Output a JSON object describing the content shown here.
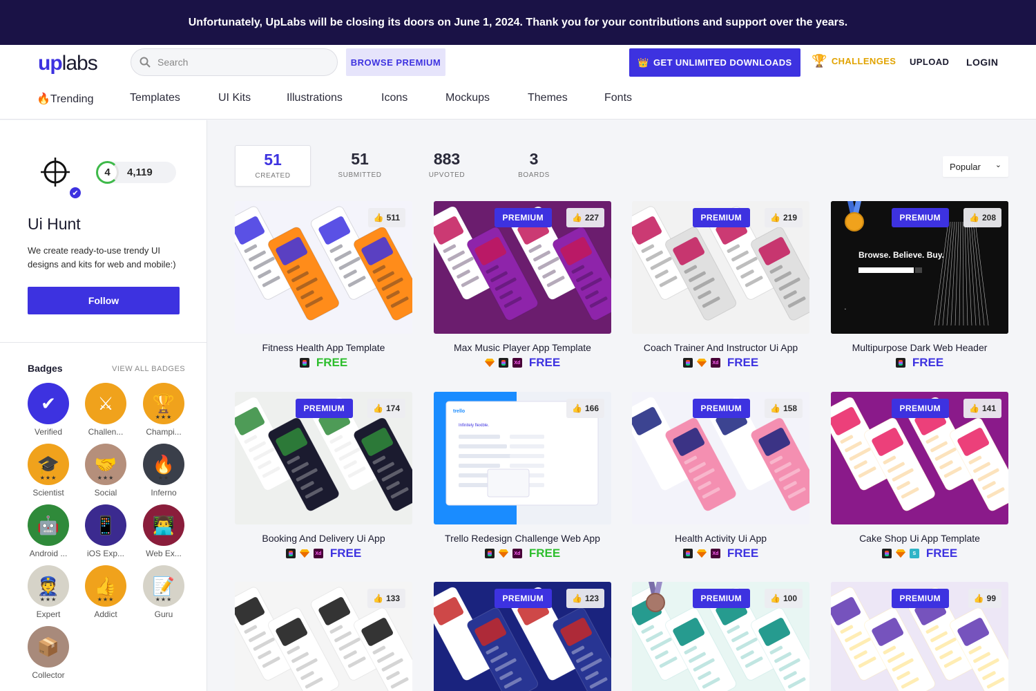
{
  "banner": "Unfortunately, UpLabs will be closing its doors on June 1, 2024. Thank you for your contributions and support over the years.",
  "header": {
    "logo_up": "up",
    "logo_labs": "labs",
    "search_placeholder": "Search",
    "browse_premium": "BROWSE PREMIUM",
    "unlimited": "GET UNLIMITED DOWNLOADS",
    "challenges": "CHALLENGES",
    "upload": "UPLOAD",
    "login": "LOGIN"
  },
  "categories": [
    "🔥Trending",
    "Templates",
    "UI Kits",
    "Illustrations",
    "Icons",
    "Mockups",
    "Themes",
    "Fonts"
  ],
  "profile": {
    "level": "4",
    "points": "4,119",
    "name": "Ui Hunt",
    "bio": "We create ready-to-use trendy UI designs and kits for web and mobile:)",
    "follow": "Follow",
    "badges_title": "Badges",
    "view_all": "VIEW ALL BADGES"
  },
  "badges": [
    {
      "label": "Verified",
      "icon": "check-icon",
      "color": "#3d32e0",
      "glyph": "✔",
      "stars": ""
    },
    {
      "label": "Challen...",
      "icon": "swords-icon",
      "color": "#f0a21c",
      "glyph": "⚔",
      "stars": ""
    },
    {
      "label": "Champi...",
      "icon": "trophy-icon",
      "color": "#f0a21c",
      "glyph": "🏆",
      "stars": "★★★"
    },
    {
      "label": "Scientist",
      "icon": "grad-cap-icon",
      "color": "#f0a21c",
      "glyph": "🎓",
      "stars": "★★★"
    },
    {
      "label": "Social",
      "icon": "handshake-icon",
      "color": "#b58f7b",
      "glyph": "🤝",
      "stars": "★★★"
    },
    {
      "label": "Inferno",
      "icon": "fire-icon",
      "color": "#3a3f4a",
      "glyph": "🔥",
      "stars": "★★"
    },
    {
      "label": "Android ...",
      "icon": "robot-icon",
      "color": "#2f8a3a",
      "glyph": "🤖",
      "stars": ""
    },
    {
      "label": "iOS Exp...",
      "icon": "phone-icon",
      "color": "#3b2a8f",
      "glyph": "📱",
      "stars": ""
    },
    {
      "label": "Web Ex...",
      "icon": "laptop-user-icon",
      "color": "#8a1d3b",
      "glyph": "👨‍💻",
      "stars": ""
    },
    {
      "label": "Expert",
      "icon": "expert-icon",
      "color": "#d6d3c8",
      "glyph": "👮",
      "stars": "★★★"
    },
    {
      "label": "Addict",
      "icon": "thumbs-up-icon",
      "color": "#f0a21c",
      "glyph": "👍",
      "stars": "★★★"
    },
    {
      "label": "Guru",
      "icon": "notepad-icon",
      "color": "#d6d3c8",
      "glyph": "📝",
      "stars": "★★★"
    },
    {
      "label": "Collector",
      "icon": "box-icon",
      "color": "#a88a7b",
      "glyph": "📦",
      "stars": ""
    }
  ],
  "stats": [
    {
      "num": "51",
      "label": "CREATED"
    },
    {
      "num": "51",
      "label": "SUBMITTED"
    },
    {
      "num": "883",
      "label": "UPVOTED"
    },
    {
      "num": "3",
      "label": "BOARDS"
    }
  ],
  "sort": "Popular",
  "cards": [
    {
      "title": "Fitness Health App Template",
      "likes": "511",
      "premium": false,
      "tools": [
        "figma"
      ],
      "price": "FREE",
      "price_color": "green"
    },
    {
      "title": "Max Music Player App Template",
      "likes": "227",
      "premium": true,
      "tools": [
        "sketch",
        "figma",
        "xd"
      ],
      "price": "FREE",
      "price_color": "blue"
    },
    {
      "title": "Coach Trainer And Instructor Ui App",
      "likes": "219",
      "premium": true,
      "tools": [
        "figma",
        "sketch",
        "xd"
      ],
      "price": "FREE",
      "price_color": "blue"
    },
    {
      "title": "Multipurpose Dark Web Header",
      "likes": "208",
      "premium": true,
      "tools": [
        "figma"
      ],
      "price": "FREE",
      "price_color": "blue"
    },
    {
      "title": "Booking And Delivery Ui App",
      "likes": "174",
      "premium": true,
      "tools": [
        "figma",
        "sketch",
        "xd"
      ],
      "price": "FREE",
      "price_color": "blue"
    },
    {
      "title": "Trello Redesign Challenge Web App",
      "likes": "166",
      "premium": false,
      "tools": [
        "figma",
        "sketch",
        "xd"
      ],
      "price": "FREE",
      "price_color": "green"
    },
    {
      "title": "Health Activity Ui App",
      "likes": "158",
      "premium": true,
      "tools": [
        "figma",
        "sketch",
        "xd"
      ],
      "price": "FREE",
      "price_color": "blue"
    },
    {
      "title": "Cake Shop Ui App Template",
      "likes": "141",
      "premium": true,
      "tools": [
        "figma",
        "sketch",
        "studio"
      ],
      "price": "FREE",
      "price_color": "blue"
    },
    {
      "title": "",
      "likes": "133",
      "premium": false,
      "tools": [],
      "price": "",
      "price_color": "green"
    },
    {
      "title": "",
      "likes": "123",
      "premium": true,
      "tools": [],
      "price": "",
      "price_color": "blue"
    },
    {
      "title": "",
      "likes": "100",
      "premium": true,
      "tools": [],
      "price": "",
      "price_color": "blue"
    },
    {
      "title": "",
      "likes": "99",
      "premium": true,
      "tools": [],
      "price": "",
      "price_color": "blue"
    }
  ],
  "premium_label": "PREMIUM",
  "thumb_overlay": {
    "browse_headline": "Browse. Believe. Buy.",
    "trello_logo": "trello",
    "trello_headline": "Infinitely flexible."
  }
}
